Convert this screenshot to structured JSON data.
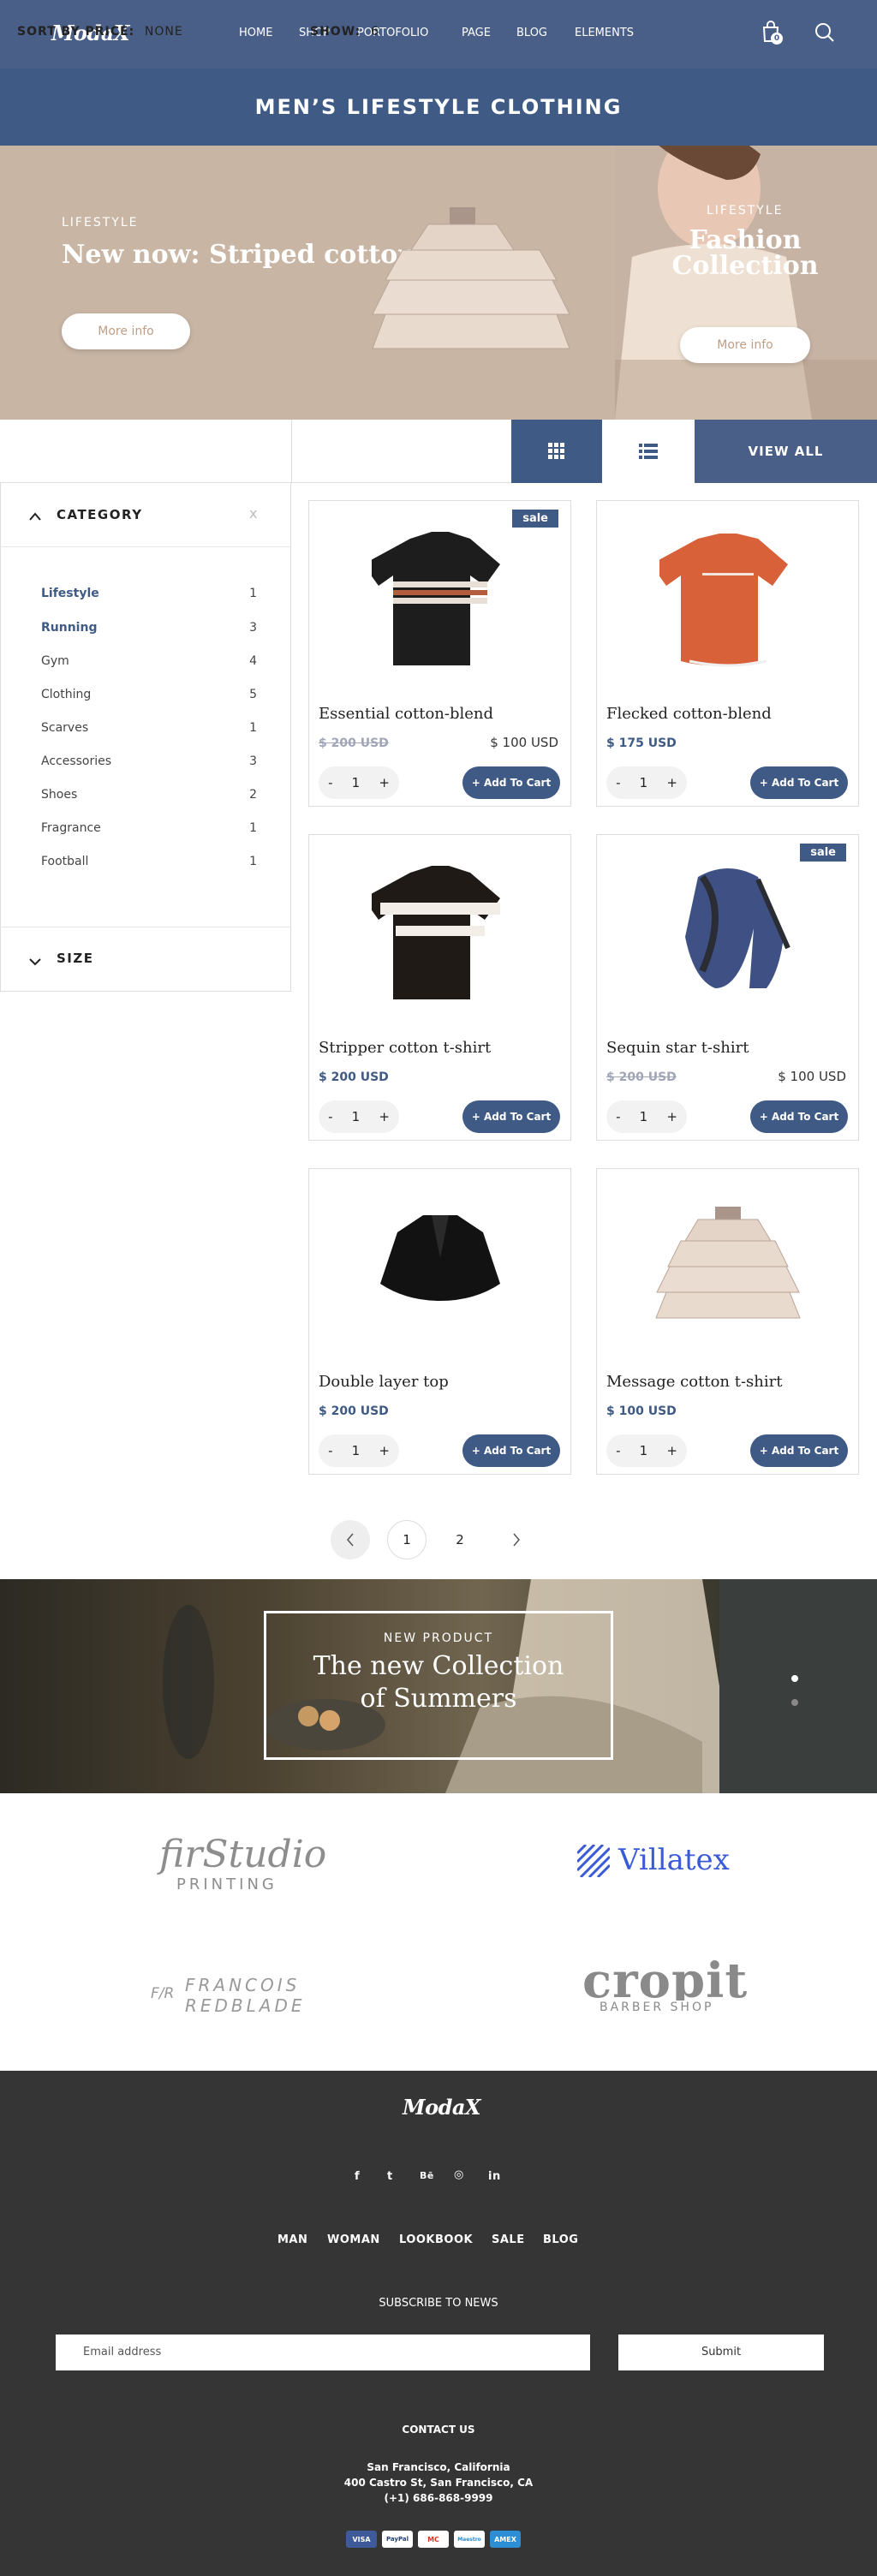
{
  "header": {
    "logo": "ModaX",
    "nav": [
      "HOME",
      "SHOP",
      "PORTOFOLIO",
      "PAGE",
      "BLOG",
      "ELEMENTS"
    ],
    "cart_count": "0"
  },
  "page_title": "MEN’S LIFESTYLE CLOTHING",
  "hero": {
    "left": {
      "kicker": "LIFESTYLE",
      "title": "New now: Striped cotton",
      "button": "More info"
    },
    "right": {
      "kicker": "LIFESTYLE",
      "title_line1": "Fashion",
      "title_line2": "Collection",
      "button": "More info"
    }
  },
  "toolbar": {
    "sort_label": "SORT BY PRICE:",
    "sort_value": "NONE",
    "show_label": "SHOW:",
    "show_value": "6",
    "view_all": "VIEW ALL"
  },
  "sidebar": {
    "category_title": "CATEGORY",
    "close": "x",
    "categories": [
      {
        "label": "Lifestyle",
        "count": "1"
      },
      {
        "label": "Running",
        "count": "3"
      },
      {
        "label": "Gym",
        "count": "4"
      },
      {
        "label": "Clothing",
        "count": "5"
      },
      {
        "label": "Scarves",
        "count": "1"
      },
      {
        "label": "Accessories",
        "count": "3"
      },
      {
        "label": "Shoes",
        "count": "2"
      },
      {
        "label": "Fragrance",
        "count": "1"
      },
      {
        "label": "Football",
        "count": "1"
      }
    ],
    "size_title": "SIZE"
  },
  "products": [
    {
      "name": "Essential cotton-blend",
      "old_price": "$ 200 USD",
      "price": "$ 100 USD",
      "sale": "sale",
      "qty": "1",
      "minus": "-",
      "plus": "+",
      "add": "+ Add To Cart"
    },
    {
      "name": "Flecked cotton-blend",
      "price": "$ 175 USD",
      "qty": "1",
      "minus": "-",
      "plus": "+",
      "add": "+ Add To Cart"
    },
    {
      "name": "Stripper cotton t-shirt",
      "price": "$ 200 USD",
      "qty": "1",
      "minus": "-",
      "plus": "+",
      "add": "+ Add To Cart"
    },
    {
      "name": "Sequin star t-shirt",
      "old_price": "$ 200 USD",
      "price": "$ 100 USD",
      "sale": "sale",
      "qty": "1",
      "minus": "-",
      "plus": "+",
      "add": "+ Add To Cart"
    },
    {
      "name": "Double layer top",
      "price": "$ 200 USD",
      "qty": "1",
      "minus": "-",
      "plus": "+",
      "add": "+ Add To Cart"
    },
    {
      "name": "Message cotton t-shirt",
      "price": "$ 100 USD",
      "qty": "1",
      "minus": "-",
      "plus": "+",
      "add": "+ Add To Cart"
    }
  ],
  "pagination": {
    "pages": [
      "1",
      "2"
    ]
  },
  "promo": {
    "kicker": "NEW PRODUCT",
    "title_line1": "The new Collection",
    "title_line2": "of Summers"
  },
  "brands": {
    "b1_main": "firStudio",
    "b1_sub": "PRINTING",
    "b2": "Villatex",
    "b3_mono": "F/R",
    "b3_line1": "FRANCOIS",
    "b3_line2": "REDBLADE",
    "b4_main": "cropit",
    "b4_sub": "BARBER SHOP"
  },
  "footer": {
    "logo": "ModaX",
    "social": [
      "f",
      "t",
      "Bē",
      "◎",
      "in"
    ],
    "nav": [
      "MAN",
      "WOMAN",
      "LOOKBOOK",
      "SALE",
      "BLOG"
    ],
    "subscribe_title": "SUBSCRIBE TO NEWS",
    "email_placeholder": "Email address",
    "submit": "Submit",
    "contact_title": "CONTACT US",
    "address1": "San Francisco, California",
    "address2": "400 Castro St, San Francisco, CA",
    "phone": "(+1) 686-868-9999",
    "payments": [
      "VISA",
      "PayPal",
      "MC",
      "Maestro",
      "AMEX"
    ]
  },
  "colors": {
    "brand": "#3e5a85",
    "header": "#4a5f87",
    "footer": "#353535",
    "hero": "#c8b5a4"
  }
}
